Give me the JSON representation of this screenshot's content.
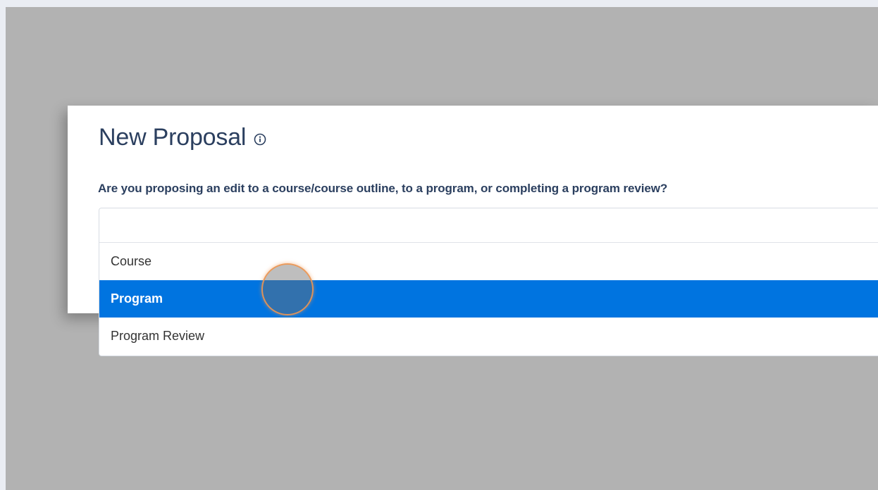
{
  "modal": {
    "title": "New Proposal",
    "question": "Are you proposing an edit to a course/course outline, to a program, or completing a program review?"
  },
  "select": {
    "value": "",
    "options": [
      {
        "label": "Course",
        "selected": false
      },
      {
        "label": "Program",
        "selected": true
      },
      {
        "label": "Program Review",
        "selected": false
      }
    ]
  },
  "colors": {
    "accent": "#0074e0",
    "title": "#2b3f5f",
    "backdrop": "#b2b2b2"
  },
  "icons": {
    "title_icon": "info-icon"
  }
}
